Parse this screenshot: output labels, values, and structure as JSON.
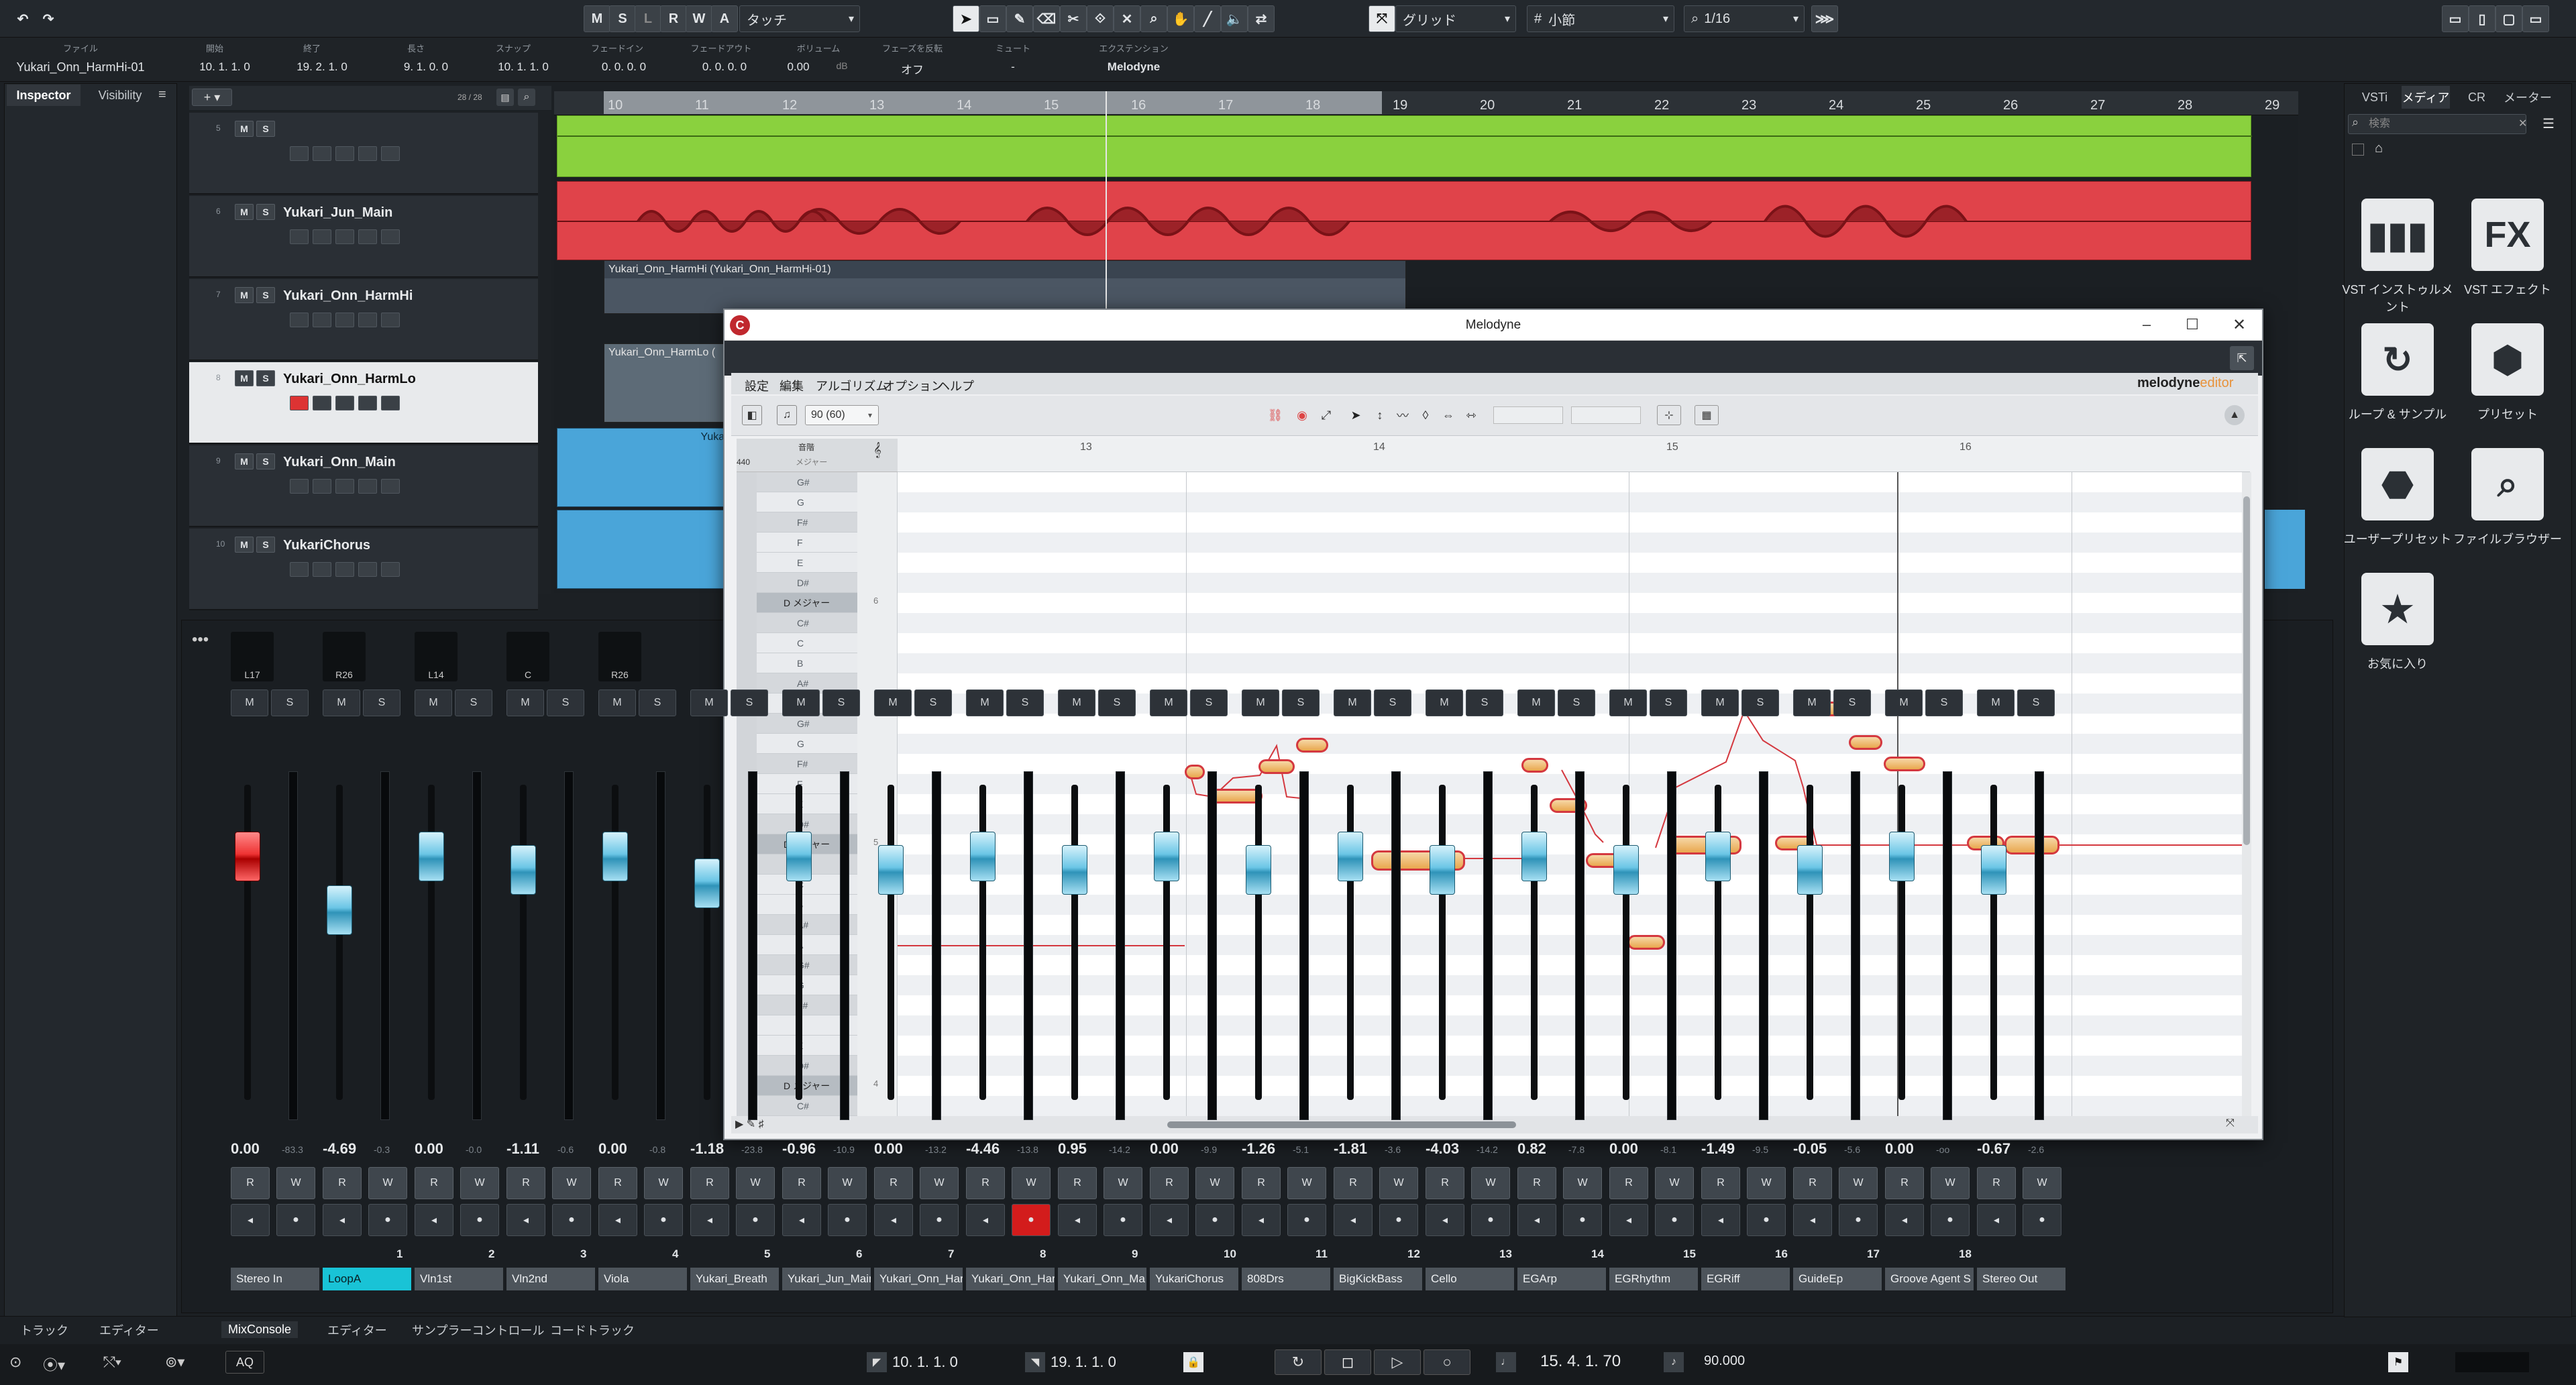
{
  "toolbar": {
    "undo_icon": "undo-icon",
    "redo_icon": "redo-icon",
    "m": "M",
    "s": "S",
    "l": "L",
    "r": "R",
    "w": "W",
    "a": "A",
    "auto_mode": "タッチ",
    "grid_type": "グリッド",
    "grid_unit": "小節",
    "quantize": "1/16"
  },
  "info_line": {
    "file_label": "ファイル",
    "file": "Yukari_Onn_HarmHi-01",
    "start_label": "開始",
    "start": "10. 1. 1.  0",
    "end_label": "終了",
    "end": "19. 2. 1.  0",
    "length_label": "長さ",
    "length": "9. 1. 0.  0",
    "snap_label": "スナップ",
    "snap": "10. 1. 1.  0",
    "fadein_label": "フェードイン",
    "fadein": "0. 0. 0.  0",
    "fadeout_label": "フェードアウト",
    "fadeout": "0. 0. 0.  0",
    "volume_label": "ボリューム",
    "volume": "0.00",
    "volume_unit": "dB",
    "phase_label": "フェーズを反転",
    "phase": "オフ",
    "mute_label": "ミュート",
    "mute": "-",
    "ext_label": "エクステンション",
    "ext": "Melodyne"
  },
  "inspector": {
    "tab1": "Inspector",
    "tab2": "Visibility"
  },
  "track_list": {
    "counter": "28 / 28",
    "tracks": [
      {
        "num": "5",
        "name": ""
      },
      {
        "num": "6",
        "name": "Yukari_Jun_Main"
      },
      {
        "num": "7",
        "name": "Yukari_Onn_HarmHi"
      },
      {
        "num": "8",
        "name": "Yukari_Onn_HarmLo"
      },
      {
        "num": "9",
        "name": "Yukari_Onn_Main"
      },
      {
        "num": "10",
        "name": "YukariChorus"
      }
    ]
  },
  "ruler": [
    "10",
    "11",
    "12",
    "13",
    "14",
    "15",
    "16",
    "17",
    "18",
    "19",
    "20",
    "21",
    "22",
    "23",
    "24",
    "25",
    "26",
    "27",
    "28",
    "29"
  ],
  "events": {
    "harmhi_title": "Yukari_Onn_HarmHi (Yukari_Onn_HarmHi-01)",
    "harmlo_title": "Yukari_Onn_HarmLo (",
    "main_title": "Yukari"
  },
  "melodyne": {
    "title": "Melodyne",
    "menu": [
      "設定",
      "編集",
      "アルゴリズム",
      "オプション",
      "ヘルプ"
    ],
    "brand": "melodyne",
    "brand_sub": "editor",
    "tempo": "90 (60)",
    "ref_pitch": "440",
    "scale_header": "音階",
    "scale_sub": "メジャー",
    "bars": [
      "13",
      "14",
      "15",
      "16"
    ],
    "keys": [
      "G#",
      "G",
      "F#",
      "F",
      "E",
      "D#",
      "D メジャー",
      "C#",
      "C",
      "B",
      "A#",
      "A",
      "G#",
      "G",
      "F#",
      "F",
      "E",
      "D#",
      "D メジャー",
      "C#",
      "C",
      "B",
      "A#",
      "A",
      "G#",
      "G",
      "F#",
      "F",
      "E",
      "D#",
      "D メジャー",
      "C#"
    ],
    "octaves": [
      "6",
      "5",
      "4"
    ]
  },
  "mixer": {
    "channels": [
      {
        "idx": "",
        "name": "Stereo In",
        "vol": "0.00",
        "sub": "-83.3",
        "pan": "L17"
      },
      {
        "idx": "1",
        "name": "LoopA",
        "vol": "-4.69",
        "sub": "-0.3",
        "pan": "R26"
      },
      {
        "idx": "2",
        "name": "Vln1st",
        "vol": "0.00",
        "sub": "-0.0",
        "pan": "L14"
      },
      {
        "idx": "3",
        "name": "Vln2nd",
        "vol": "-1.11",
        "sub": "-0.6",
        "pan": "C"
      },
      {
        "idx": "4",
        "name": "Viola",
        "vol": "0.00",
        "sub": "-0.8",
        "pan": "R26"
      },
      {
        "idx": "5",
        "name": "Yukari_Breath",
        "vol": "-1.18",
        "sub": "-23.8",
        "pan": ""
      },
      {
        "idx": "6",
        "name": "Yukari_Jun_Main",
        "vol": "-0.96",
        "sub": "-10.9",
        "pan": ""
      },
      {
        "idx": "7",
        "name": "Yukari_Onn_Harm",
        "vol": "0.00",
        "sub": "-13.2",
        "pan": ""
      },
      {
        "idx": "8",
        "name": "Yukari_Onn_Harm",
        "vol": "-4.46",
        "sub": "-13.8",
        "pan": ""
      },
      {
        "idx": "9",
        "name": "Yukari_Onn_Ma",
        "vol": "0.95",
        "sub": "-14.2",
        "pan": ""
      },
      {
        "idx": "10",
        "name": "YukariChorus",
        "vol": "0.00",
        "sub": "-9.9",
        "pan": ""
      },
      {
        "idx": "11",
        "name": "808Drs",
        "vol": "-1.26",
        "sub": "-5.1",
        "pan": ""
      },
      {
        "idx": "12",
        "name": "BigKickBass",
        "vol": "-1.81",
        "sub": "-3.6",
        "pan": ""
      },
      {
        "idx": "13",
        "name": "Cello",
        "vol": "-4.03",
        "sub": "-14.2",
        "pan": ""
      },
      {
        "idx": "14",
        "name": "EGArp",
        "vol": "0.82",
        "sub": "-7.8",
        "pan": ""
      },
      {
        "idx": "15",
        "name": "EGRhythm",
        "vol": "0.00",
        "sub": "-8.1",
        "pan": ""
      },
      {
        "idx": "16",
        "name": "EGRiff",
        "vol": "-1.49",
        "sub": "-9.5",
        "pan": ""
      },
      {
        "idx": "17",
        "name": "GuideEp",
        "vol": "-0.05",
        "sub": "-5.6",
        "pan": ""
      },
      {
        "idx": "18",
        "name": "Groove Agent S",
        "vol": "0.00",
        "sub": "-oo",
        "pan": ""
      },
      {
        "idx": "",
        "name": "Stereo Out",
        "vol": "-0.67",
        "sub": "-2.6",
        "pan": ""
      }
    ]
  },
  "bottom_tabs": [
    "トラック",
    "エディター",
    "MixConsole",
    "エディター",
    "サンプラーコントロール",
    "コードトラック"
  ],
  "transport": {
    "left_locator": "10. 1. 1.  0",
    "right_locator": "19. 1. 1.  0",
    "position": "15. 4. 1. 70",
    "tempo": "90.000",
    "aq": "AQ"
  },
  "media": {
    "tabs": [
      "VSTi",
      "メディア",
      "CR",
      "メーター"
    ],
    "search_placeholder": "検索",
    "tiles": [
      {
        "label": "VST インストゥルメント",
        "icon": "piano-icon"
      },
      {
        "label": "VST エフェクト",
        "icon": "fx-icon",
        "glyph": "FX"
      },
      {
        "label": "ループ & サンプル",
        "icon": "loop-icon"
      },
      {
        "label": "プリセット",
        "icon": "hexagon-icon"
      },
      {
        "label": "ユーザープリセット",
        "icon": "user-preset-icon"
      },
      {
        "label": "ファイルブラウザー",
        "icon": "file-browser-icon"
      },
      {
        "label": "お気に入り",
        "icon": "star-icon"
      }
    ]
  },
  "colors": {
    "green": "#8ad13e",
    "red": "#e0434a",
    "blue": "#4aa5d9",
    "accent": "#19c3d6",
    "note_border": "#d4383f"
  }
}
